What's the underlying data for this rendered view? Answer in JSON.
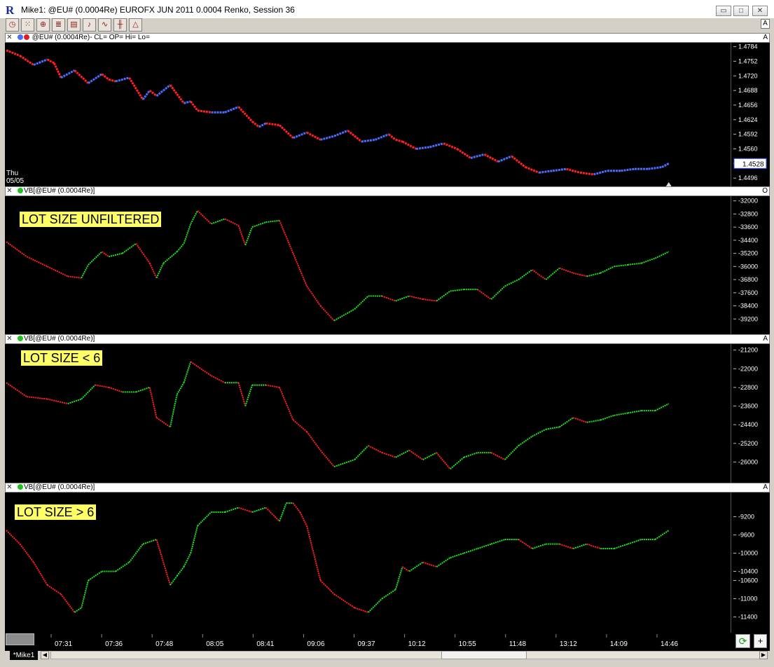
{
  "window": {
    "title": "Mike1: @EU# (0.0004Re) EUROFX JUN 2011 0.0004 Renko, Session 36",
    "minimize": "▭",
    "maximize": "□",
    "close": "✕",
    "corner_flag": "A"
  },
  "toolbar": [
    {
      "name": "clock-icon",
      "glyph": "◷"
    },
    {
      "name": "dots-icon",
      "glyph": "⁙"
    },
    {
      "name": "zoom-icon",
      "glyph": "⊕"
    },
    {
      "name": "bars-icon",
      "glyph": "≣"
    },
    {
      "name": "chart-icon",
      "glyph": "▤"
    },
    {
      "name": "bell-icon",
      "glyph": "♪"
    },
    {
      "name": "line-icon",
      "glyph": "∿"
    },
    {
      "name": "lines-icon",
      "glyph": "╫"
    },
    {
      "name": "triangle-icon",
      "glyph": "△"
    }
  ],
  "panes": [
    {
      "header": "@EU# (0.0004Re)- CL= OP= Hi= Lo=",
      "corner": "A",
      "left_label": [
        "Thu",
        "05/05"
      ],
      "price_box": "1.4528"
    },
    {
      "header": "VB[@EU# (0.0004Re)]",
      "corner": "O",
      "label": "LOT SIZE UNFILTERED"
    },
    {
      "header": "VB[@EU# (0.0004Re)]",
      "corner": "A",
      "label": "LOT SIZE < 6"
    },
    {
      "header": "VB[@EU# (0.0004Re)]",
      "corner": "A",
      "label": "LOT SIZE > 6"
    }
  ],
  "time_axis": [
    "07:31",
    "07:36",
    "07:48",
    "08:05",
    "08:41",
    "09:06",
    "09:37",
    "10:12",
    "10:55",
    "11:48",
    "13:12",
    "14:09",
    "14:46"
  ],
  "tabs": {
    "active": "*Mike1"
  },
  "colors": {
    "up_price": "#4a6cff",
    "down_price": "#ff2020",
    "up": "#22e022",
    "down": "#ff2020",
    "background": "#000000",
    "label_bg": "#ffff66"
  },
  "chart_data": [
    {
      "type": "line",
      "title": "@EU# (0.0004Re)",
      "ylim": [
        1.4484,
        1.4788
      ],
      "yticks": [
        "1.4784",
        "1.4752",
        "1.4720",
        "1.4688",
        "1.4656",
        "1.4624",
        "1.4592",
        "1.4560",
        "1.4528",
        "1.4496"
      ],
      "x": [
        0,
        2,
        4,
        6,
        7,
        8,
        10,
        12,
        14,
        15,
        16,
        18,
        20,
        21,
        22,
        24,
        26,
        27,
        28,
        30,
        32,
        34,
        36,
        37,
        38,
        40,
        42,
        44,
        46,
        48,
        50,
        52,
        54,
        56,
        57,
        58,
        60,
        62,
        64,
        66,
        68,
        70,
        72,
        74,
        76,
        78,
        80,
        82,
        84,
        86,
        88,
        90,
        92,
        94,
        96,
        97
      ],
      "y": [
        1.4776,
        1.4764,
        1.4744,
        1.4756,
        1.4748,
        1.4716,
        1.4732,
        1.4704,
        1.4724,
        1.4712,
        1.4708,
        1.4716,
        1.4668,
        1.4688,
        1.4676,
        1.47,
        1.466,
        1.4664,
        1.4644,
        1.464,
        1.464,
        1.4652,
        1.462,
        1.4608,
        1.4616,
        1.4612,
        1.4584,
        1.4596,
        1.458,
        1.4588,
        1.46,
        1.4576,
        1.458,
        1.4592,
        1.458,
        1.4576,
        1.456,
        1.4564,
        1.4572,
        1.456,
        1.454,
        1.4548,
        1.4532,
        1.4544,
        1.452,
        1.4508,
        1.4512,
        1.4516,
        1.4508,
        1.4504,
        1.4512,
        1.4512,
        1.4516,
        1.4516,
        1.452,
        1.4528
      ]
    },
    {
      "type": "line",
      "title": "LOT SIZE UNFILTERED",
      "ylim": [
        -40000,
        -31800
      ],
      "yticks": [
        "-32000",
        "-32800",
        "-33600",
        "-34400",
        "-35200",
        "-36000",
        "-36800",
        "-37600",
        "-38400",
        "-39200"
      ],
      "x": [
        0,
        3,
        6,
        9,
        11,
        12,
        14,
        15,
        17,
        19,
        21,
        22,
        23,
        25,
        26,
        27,
        28,
        30,
        32,
        34,
        35,
        36,
        38,
        40,
        42,
        44,
        46,
        48,
        51,
        53,
        55,
        57,
        59,
        61,
        63,
        65,
        67,
        69,
        71,
        73,
        75,
        77,
        79,
        81,
        83,
        85,
        87,
        89,
        91,
        93,
        95,
        97
      ],
      "y": [
        -34500,
        -35400,
        -36000,
        -36600,
        -36700,
        -35900,
        -35100,
        -35400,
        -35200,
        -34600,
        -35800,
        -36700,
        -35800,
        -35100,
        -34600,
        -33400,
        -32600,
        -33400,
        -33100,
        -33500,
        -34700,
        -33600,
        -33300,
        -33200,
        -35200,
        -37200,
        -38400,
        -39300,
        -38600,
        -37800,
        -37800,
        -38100,
        -37800,
        -38000,
        -38100,
        -37500,
        -37400,
        -37400,
        -38000,
        -37200,
        -36800,
        -36200,
        -36800,
        -36100,
        -36400,
        -36600,
        -36400,
        -36000,
        -35900,
        -35800,
        -35500,
        -35100
      ]
    },
    {
      "type": "line",
      "title": "LOT SIZE < 6",
      "ylim": [
        -26800,
        -21000
      ],
      "yticks": [
        "-21200",
        "-22000",
        "-22800",
        "-23600",
        "-24400",
        "-25200",
        "-26000"
      ],
      "x": [
        0,
        3,
        6,
        9,
        11,
        13,
        15,
        17,
        19,
        21,
        22,
        24,
        25,
        26,
        27,
        28,
        30,
        32,
        34,
        35,
        36,
        38,
        40,
        42,
        44,
        46,
        48,
        51,
        53,
        55,
        57,
        59,
        61,
        63,
        65,
        67,
        69,
        71,
        73,
        75,
        77,
        79,
        81,
        83,
        85,
        87,
        89,
        91,
        93,
        95,
        97
      ],
      "y": [
        -22600,
        -23200,
        -23300,
        -23500,
        -23300,
        -22700,
        -22800,
        -23000,
        -23000,
        -22800,
        -24100,
        -24500,
        -23100,
        -22600,
        -21700,
        -21900,
        -22300,
        -22600,
        -22600,
        -23600,
        -22700,
        -22700,
        -22800,
        -24200,
        -24700,
        -25500,
        -26200,
        -25900,
        -25300,
        -25600,
        -25800,
        -25500,
        -25900,
        -25600,
        -26300,
        -25800,
        -25600,
        -25600,
        -25900,
        -25300,
        -24900,
        -24600,
        -24500,
        -24100,
        -24300,
        -24200,
        -24000,
        -23900,
        -23800,
        -23800,
        -23500
      ]
    },
    {
      "type": "line",
      "title": "LOT SIZE > 6",
      "ylim": [
        -11700,
        -8700
      ],
      "yticks": [
        "-9200",
        "-9600",
        "-10000",
        "-10400",
        "-10600",
        "-11000",
        "-11400"
      ],
      "x": [
        0,
        2,
        4,
        6,
        8,
        10,
        11,
        12,
        14,
        16,
        18,
        20,
        22,
        24,
        25,
        26,
        27,
        28,
        30,
        32,
        34,
        36,
        38,
        40,
        41,
        42,
        43,
        44,
        46,
        48,
        51,
        53,
        55,
        57,
        58,
        59,
        61,
        63,
        65,
        67,
        69,
        71,
        73,
        75,
        77,
        79,
        81,
        83,
        85,
        87,
        89,
        91,
        93,
        95,
        97
      ],
      "y": [
        -9500,
        -9800,
        -10200,
        -10700,
        -10900,
        -11300,
        -11200,
        -10600,
        -10400,
        -10400,
        -10200,
        -9800,
        -9700,
        -10700,
        -10500,
        -10300,
        -10000,
        -9400,
        -9100,
        -9100,
        -9000,
        -9100,
        -9000,
        -9300,
        -8900,
        -8900,
        -9100,
        -9400,
        -10600,
        -10900,
        -11200,
        -11300,
        -11000,
        -10800,
        -10300,
        -10400,
        -10200,
        -10300,
        -10100,
        -10000,
        -9900,
        -9800,
        -9700,
        -9700,
        -9900,
        -9800,
        -9800,
        -9900,
        -9800,
        -9900,
        -9900,
        -9800,
        -9700,
        -9700,
        -9500
      ]
    }
  ]
}
